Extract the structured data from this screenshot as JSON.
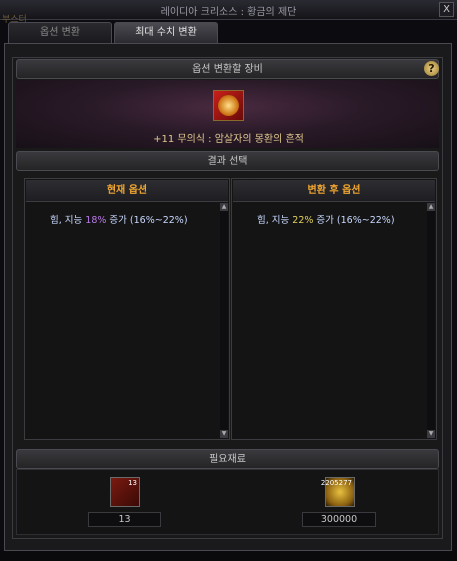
{
  "window": {
    "title": "레이디아 크리소스 : 황금의 제단",
    "bg_left_text": "부스터",
    "close_label": "X"
  },
  "tabs": [
    {
      "label": "옵션 변환",
      "active": false
    },
    {
      "label": "최대 수치 변환",
      "active": true
    }
  ],
  "equipment": {
    "header": "옵션 변환할 장비",
    "help_label": "?",
    "item_name": "+11 무의식 : 암살자의 몽환의 흔적"
  },
  "result": {
    "header": "결과 선택",
    "current": {
      "header": "현재 옵션",
      "prefix": "힘, 지능 ",
      "value": "18%",
      "suffix": " 증가 (16%~22%)"
    },
    "after": {
      "header": "변환 후 옵션",
      "prefix": "힘, 지능 ",
      "value": "22%",
      "suffix": " 증가 (16%~22%)"
    }
  },
  "materials": {
    "header": "필요재료",
    "items": [
      {
        "name": "material-stone",
        "stack": "13",
        "required": "13"
      },
      {
        "name": "gold-coins",
        "stack": "2205277",
        "required": "300000"
      }
    ]
  },
  "colors": {
    "option_header": "#f0a530",
    "current_highlight": "#b87ae8",
    "after_highlight": "#e0d060",
    "equip_name": "#e0c890"
  }
}
